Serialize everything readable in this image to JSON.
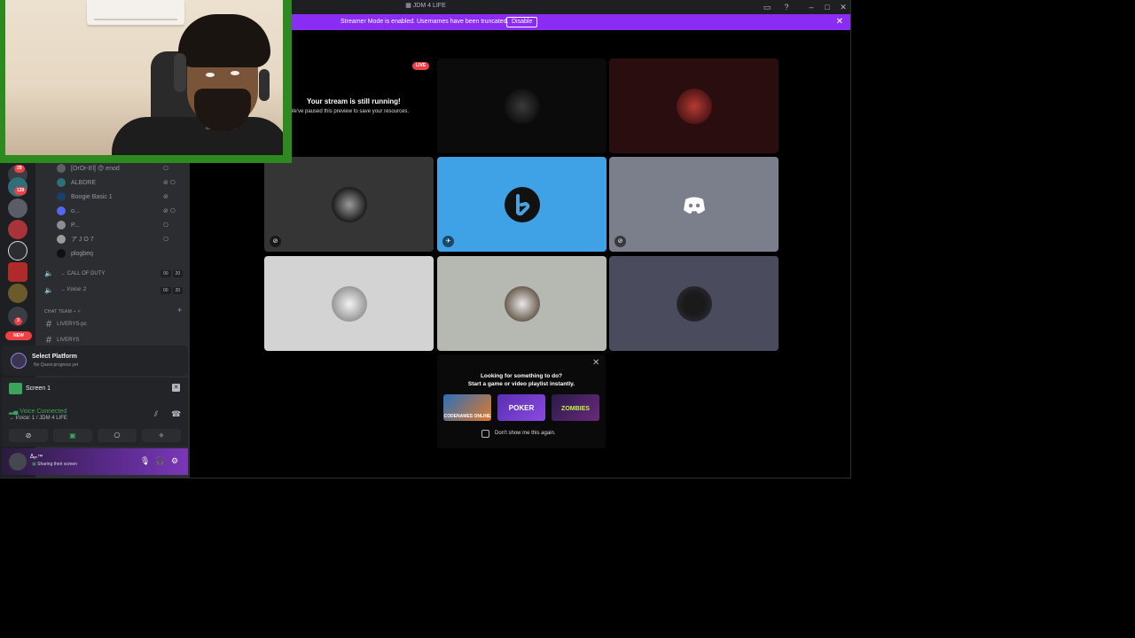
{
  "window": {
    "title": "JDM 4 LIFE"
  },
  "banner": {
    "text": "Streamer Mode is enabled. Usernames have been truncated.",
    "button": "Disable",
    "close": "✕"
  },
  "rail": {
    "badges": [
      "29",
      "139",
      "3"
    ],
    "new_label": "NEW"
  },
  "members": [
    {
      "name": "[OrOr-El] 😊 enod"
    },
    {
      "name": "ALBDRE"
    },
    {
      "name": "Boogie Basic 1"
    },
    {
      "name": "o..."
    },
    {
      "name": "P..."
    },
    {
      "name": "ア J O 7"
    },
    {
      "name": "plogbeq"
    }
  ],
  "voice_channels": [
    {
      "name": "→ CALL OF DUTY",
      "count_a": "00",
      "count_b": "20"
    },
    {
      "name": "→ 𝑉𝑜𝑖𝑐𝑒: 2",
      "count_a": "00",
      "count_b": "20"
    }
  ],
  "category": {
    "name": "CHAT TEAM ⌁ ˅",
    "plus": "+"
  },
  "text_channels": [
    {
      "name": "LIVERYS-pc"
    },
    {
      "name": "LIVERYS"
    }
  ],
  "quest": {
    "title": "Select Platform",
    "subtitle": "No Quest progress yet"
  },
  "screen_share": {
    "label": "Screen 1"
  },
  "voice_panel": {
    "status": "Voice Connected",
    "channel": "→ 𝑉𝑜𝑖𝑐𝑒: 1 / JDM 4 LIFE"
  },
  "user_panel": {
    "name": "ᐃᵧₙ™",
    "status": "Sharing their screen"
  },
  "stage": {
    "live_badge": "LIVE",
    "paused_title": "Your stream is still running!",
    "paused_subtitle": "We've paused this preview to save your resources."
  },
  "activity": {
    "title_line1": "Looking for something to do?",
    "title_line2": "Start a game or video playlist instantly.",
    "games": [
      "CODENAMES ONLINE",
      "POKER",
      "ZOMBIES"
    ],
    "checkbox_label": "Don't show me this again.",
    "close": "✕"
  },
  "colors": {
    "accent": "#8b2cf5",
    "tile_blue": "#3fa1e6",
    "tile_grey": "#7b7f8c",
    "tile_light": "#d3d3d3",
    "tile_sage": "#b6b8b2",
    "tile_slate": "#4a4c5e",
    "tile_darkred": "#2a0d0e",
    "webcam_border": "#2c8a1e"
  }
}
